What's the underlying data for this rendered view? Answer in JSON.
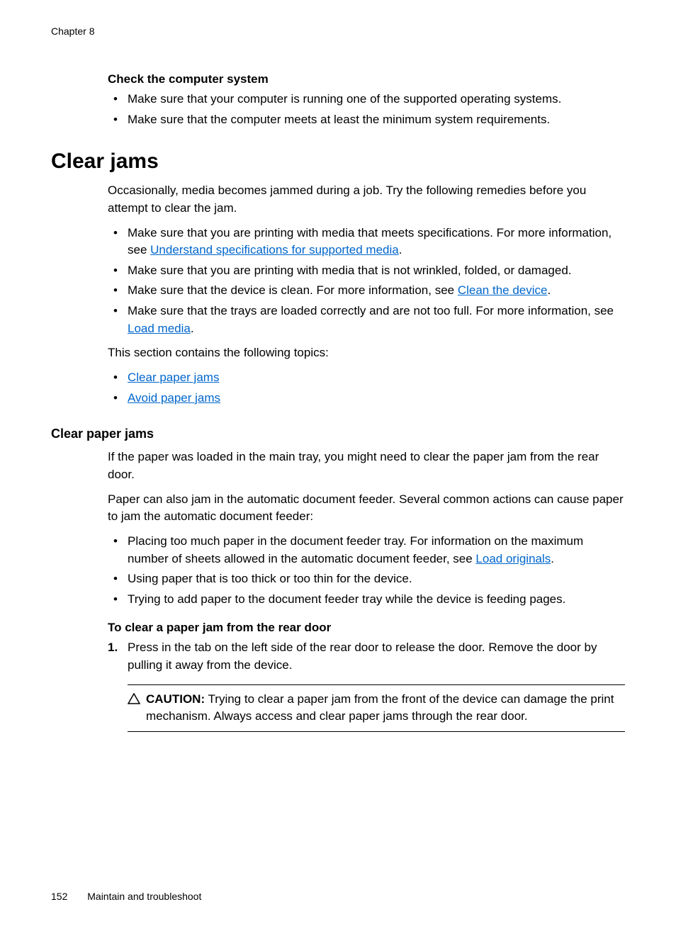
{
  "chapter": "Chapter 8",
  "check_system": {
    "heading": "Check the computer system",
    "bullet1": "Make sure that your computer is running one of the supported operating systems.",
    "bullet2": "Make sure that the computer meets at least the minimum system requirements."
  },
  "clear_jams": {
    "heading": "Clear jams",
    "intro": "Occasionally, media becomes jammed during a job. Try the following remedies before you attempt to clear the jam.",
    "b1_pre": "Make sure that you are printing with media that meets specifications. For more information, see ",
    "b1_link": "Understand specifications for supported media",
    "b1_post": ".",
    "b2": "Make sure that you are printing with media that is not wrinkled, folded, or damaged.",
    "b3_pre": "Make sure that the device is clean. For more information, see ",
    "b3_link": "Clean the device",
    "b3_post": ".",
    "b4_pre": "Make sure that the trays are loaded correctly and are not too full. For more information, see ",
    "b4_link": "Load media",
    "b4_post": ".",
    "topics_intro": "This section contains the following topics:",
    "topic1": "Clear paper jams",
    "topic2": "Avoid paper jams"
  },
  "clear_paper_jams": {
    "heading": "Clear paper jams",
    "p1": "If the paper was loaded in the main tray, you might need to clear the paper jam from the rear door.",
    "p2": "Paper can also jam in the automatic document feeder. Several common actions can cause paper to jam the automatic document feeder:",
    "b1_pre": "Placing too much paper in the document feeder tray. For information on the maximum number of sheets allowed in the automatic document feeder, see ",
    "b1_link": "Load originals",
    "b1_post": ".",
    "b2": "Using paper that is too thick or too thin for the device.",
    "b3": "Trying to add paper to the document feeder tray while the device is feeding pages.",
    "procedure_heading": "To clear a paper jam from the rear door",
    "step1": "Press in the tab on the left side of the rear door to release the door. Remove the door by pulling it away from the device.",
    "caution_label": "CAUTION:",
    "caution_text": "Trying to clear a paper jam from the front of the device can damage the print mechanism. Always access and clear paper jams through the rear door."
  },
  "footer": {
    "page": "152",
    "section": "Maintain and troubleshoot"
  }
}
